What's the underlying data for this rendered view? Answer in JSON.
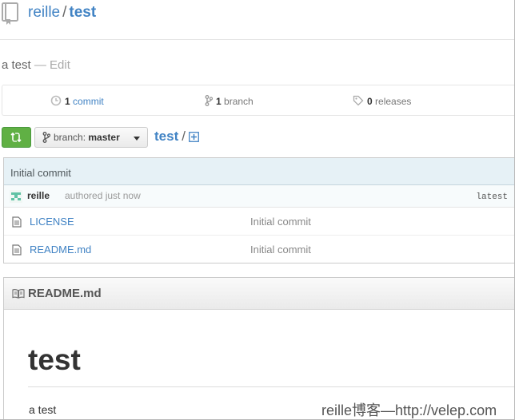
{
  "repo": {
    "owner": "reille",
    "separator": "/",
    "name": "test",
    "description": "a test",
    "edit_label": "Edit",
    "desc_dash": "—"
  },
  "summary": {
    "commits_count": "1",
    "commits_label": "commit",
    "branches_count": "1",
    "branches_label": "branch",
    "releases_count": "0",
    "releases_label": "releases"
  },
  "file_nav": {
    "branch_prefix": "branch:",
    "branch_name": "master",
    "breadcrumb_root": "test",
    "breadcrumb_sep": "/"
  },
  "commit": {
    "message": "Initial commit",
    "author": "reille",
    "time": "authored just now",
    "latest_label": "latest"
  },
  "files": [
    {
      "name": "LICENSE",
      "message": "Initial commit"
    },
    {
      "name": "README.md",
      "message": "Initial commit"
    }
  ],
  "readme": {
    "filename": "README.md",
    "heading": "test",
    "body": "a test"
  },
  "watermark": "reille博客—http://velep.com",
  "colors": {
    "link": "#4183c4",
    "compare_button": "#60b044",
    "commit_bar": "#e6f1f6"
  }
}
